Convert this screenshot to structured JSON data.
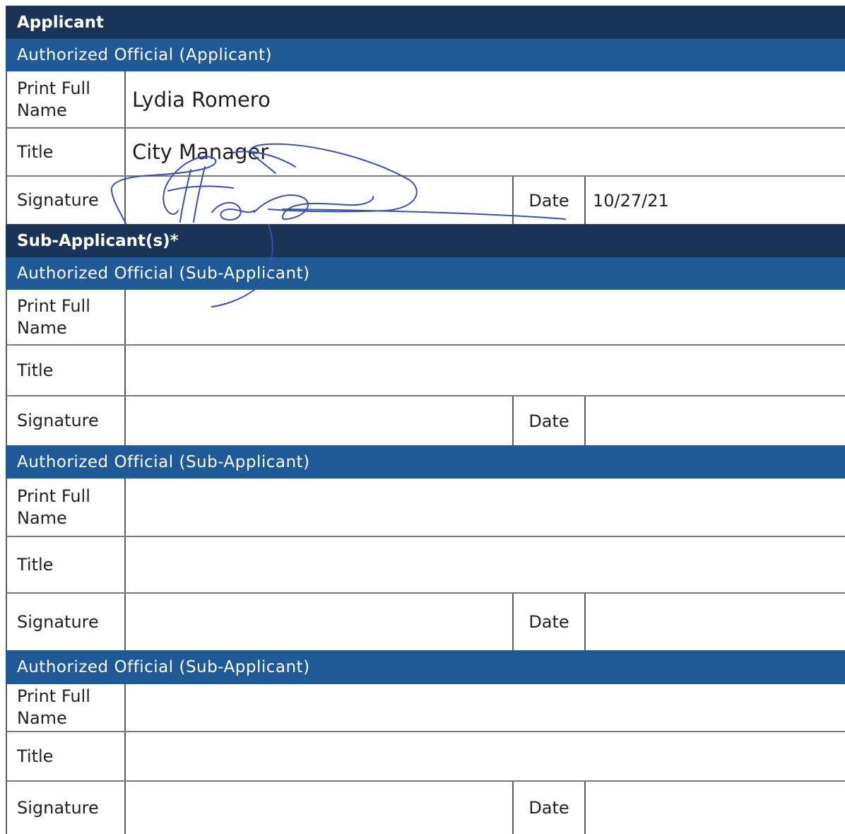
{
  "applicant": {
    "header": "Applicant",
    "official_header": "Authorized Official (Applicant)",
    "print_full_name_label": "Print Full Name",
    "print_full_name_value": "Lydia Romero",
    "title_label": "Title",
    "title_value": "City Manager",
    "signature_label": "Signature",
    "date_label": "Date",
    "date_value": "10/27/21"
  },
  "sub_applicants": {
    "header": "Sub-Applicant(s)*",
    "officials": [
      {
        "official_header": "Authorized Official (Sub-Applicant)",
        "print_full_name_label": "Print Full Name",
        "print_full_name_value": "",
        "title_label": "Title",
        "title_value": "",
        "signature_label": "Signature",
        "date_label": "Date",
        "date_value": ""
      },
      {
        "official_header": "Authorized Official (Sub-Applicant)",
        "print_full_name_label": "Print Full Name",
        "print_full_name_value": "",
        "title_label": "Title",
        "title_value": "",
        "signature_label": "Signature",
        "date_label": "Date",
        "date_value": ""
      },
      {
        "official_header": "Authorized Official (Sub-Applicant)",
        "print_full_name_label": "Print Full Name",
        "print_full_name_value": "",
        "title_label": "Title",
        "title_value": "",
        "signature_label": "Signature",
        "date_label": "Date",
        "date_value": ""
      }
    ]
  },
  "colors": {
    "section_header": "#1a3458",
    "official_header": "#1f5a96",
    "signature_ink": "#3a4fb0"
  }
}
